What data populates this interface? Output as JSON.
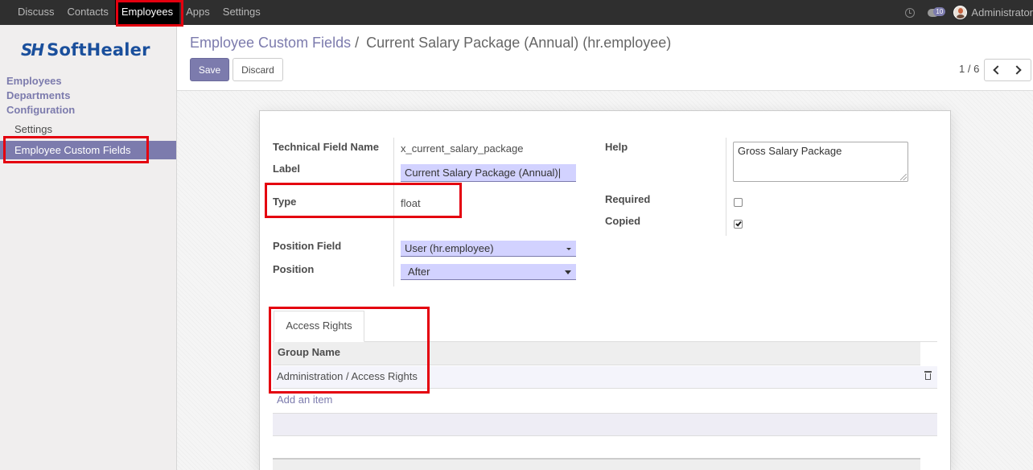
{
  "topbar": {
    "menu": [
      "Discuss",
      "Contacts",
      "Employees",
      "Apps",
      "Settings"
    ],
    "active": "Employees",
    "chat_count": "10",
    "user_name": "Administrator"
  },
  "sidebar": {
    "logo_mark": "SH",
    "logo_text": "SoftHealer",
    "sections": [
      "Employees",
      "Departments",
      "Configuration"
    ],
    "items": [
      "Settings",
      "Employee Custom Fields"
    ]
  },
  "breadcrumb": {
    "parent": "Employee Custom Fields",
    "separator": "/",
    "current": "Current Salary Package (Annual) (hr.employee)"
  },
  "buttons": {
    "save": "Save",
    "discard": "Discard"
  },
  "pager": {
    "text": "1 / 6"
  },
  "form": {
    "technical_field_name": {
      "label": "Technical Field Name",
      "value": "x_current_salary_package"
    },
    "label_field": {
      "label": "Label",
      "value": "Current Salary Package (Annual)"
    },
    "type_field": {
      "label": "Type",
      "value": "float"
    },
    "position_field": {
      "label": "Position Field",
      "value": "User (hr.employee)"
    },
    "position": {
      "label": "Position",
      "value": "After"
    },
    "help": {
      "label": "Help",
      "value": "Gross Salary Package"
    },
    "required": {
      "label": "Required",
      "checked": false
    },
    "copied": {
      "label": "Copied",
      "checked": true
    }
  },
  "tabs": [
    {
      "label": "Access Rights"
    }
  ],
  "access_table": {
    "column": "Group Name",
    "rows": [
      "Administration / Access Rights"
    ],
    "add_item": "Add an item"
  },
  "colors": {
    "accent": "#7c7bad",
    "highlight": "#e4000f",
    "navbar": "#2f2f2f"
  }
}
